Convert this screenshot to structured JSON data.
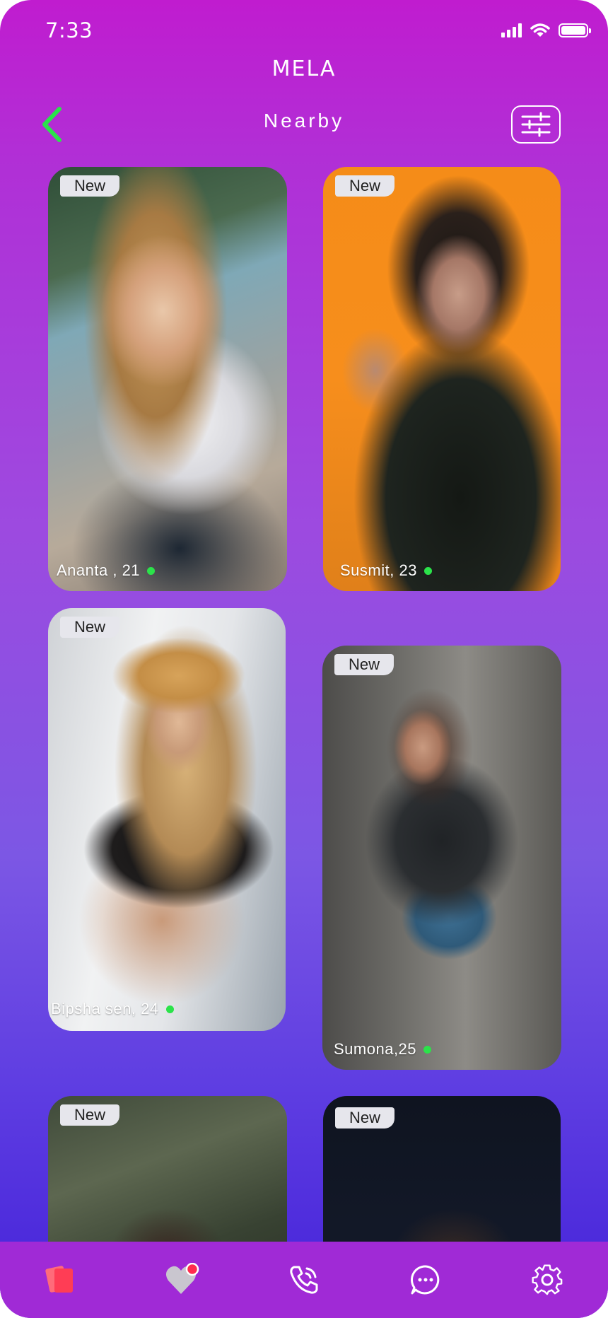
{
  "status_bar": {
    "time": "7:33"
  },
  "app": {
    "logo": "MELA",
    "title": "Nearby"
  },
  "colors": {
    "accent_green": "#2be34a",
    "nav_bg": "#a02ad6",
    "card_badge_bg": "#e6e6ec"
  },
  "icons": {
    "back": "chevron-left-icon",
    "filter": "sliders-icon",
    "nav": [
      "cards-icon",
      "heart-icon",
      "phone-icon",
      "chat-icon",
      "gear-icon"
    ]
  },
  "profiles": [
    {
      "badge": "New",
      "name": "Ananta , 21",
      "online": true
    },
    {
      "badge": "New",
      "name": "Susmit, 23",
      "online": true
    },
    {
      "badge": "New",
      "name": "Bipsha sen, 24",
      "online": true
    },
    {
      "badge": "New",
      "name": "Sumona,25",
      "online": true
    },
    {
      "badge": "New",
      "name": "",
      "online": false
    },
    {
      "badge": "New",
      "name": "",
      "online": false
    }
  ]
}
